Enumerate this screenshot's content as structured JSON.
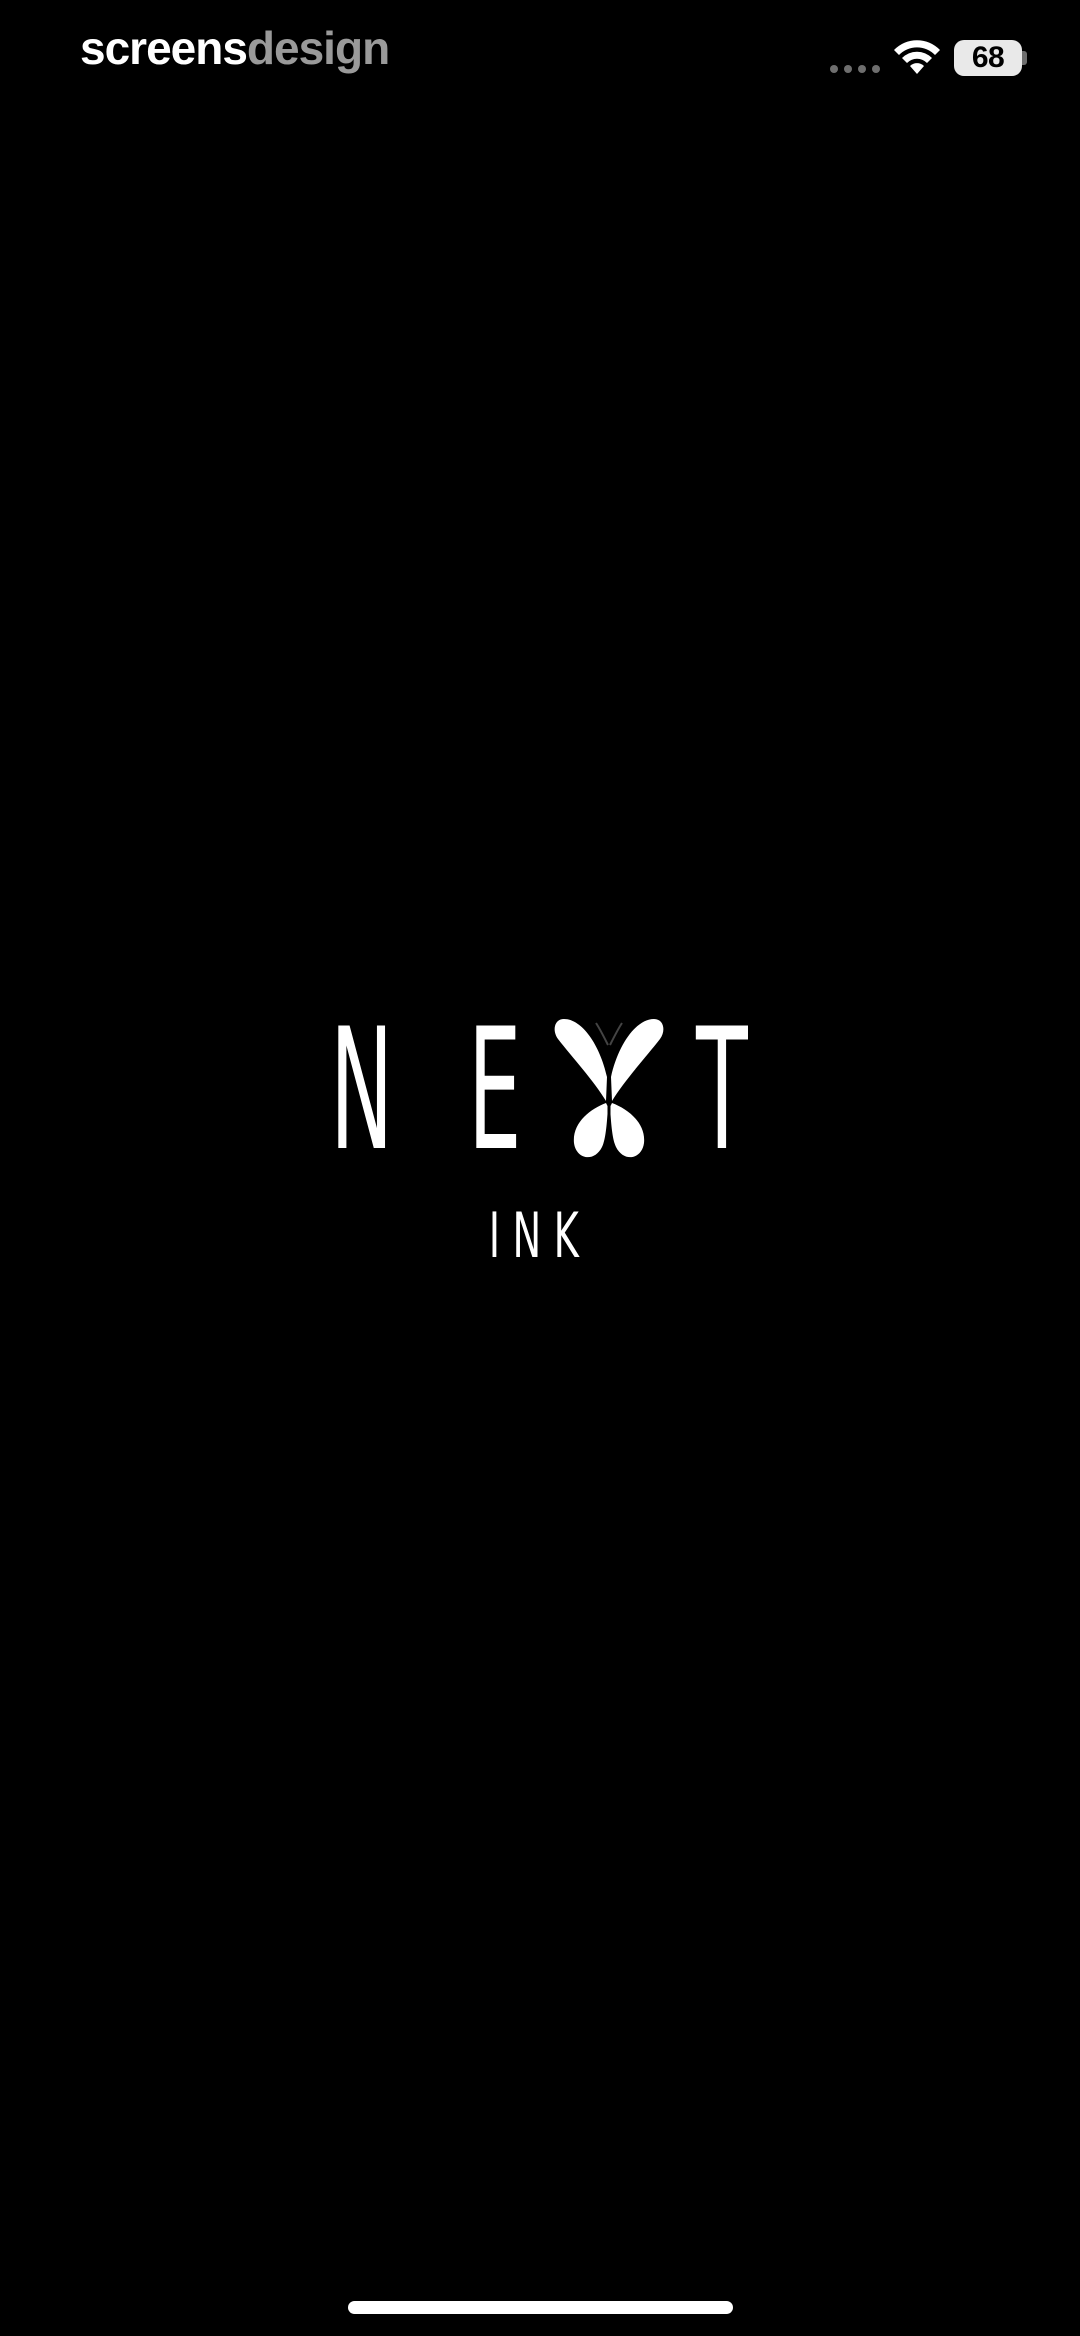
{
  "status_bar": {
    "watermark_part1": "screens",
    "watermark_part2": "design",
    "battery_level": "68",
    "signal_icon": "signal-dots-icon",
    "wifi_icon": "wifi-icon",
    "battery_icon": "battery-icon"
  },
  "logo": {
    "letter_1": "N",
    "letter_2": "E",
    "letter_3": "T",
    "butterfly_icon": "butterfly-icon",
    "subtitle": "INK"
  },
  "colors": {
    "background": "#000000",
    "foreground": "#ffffff",
    "watermark_secondary": "#9a9a9a"
  }
}
